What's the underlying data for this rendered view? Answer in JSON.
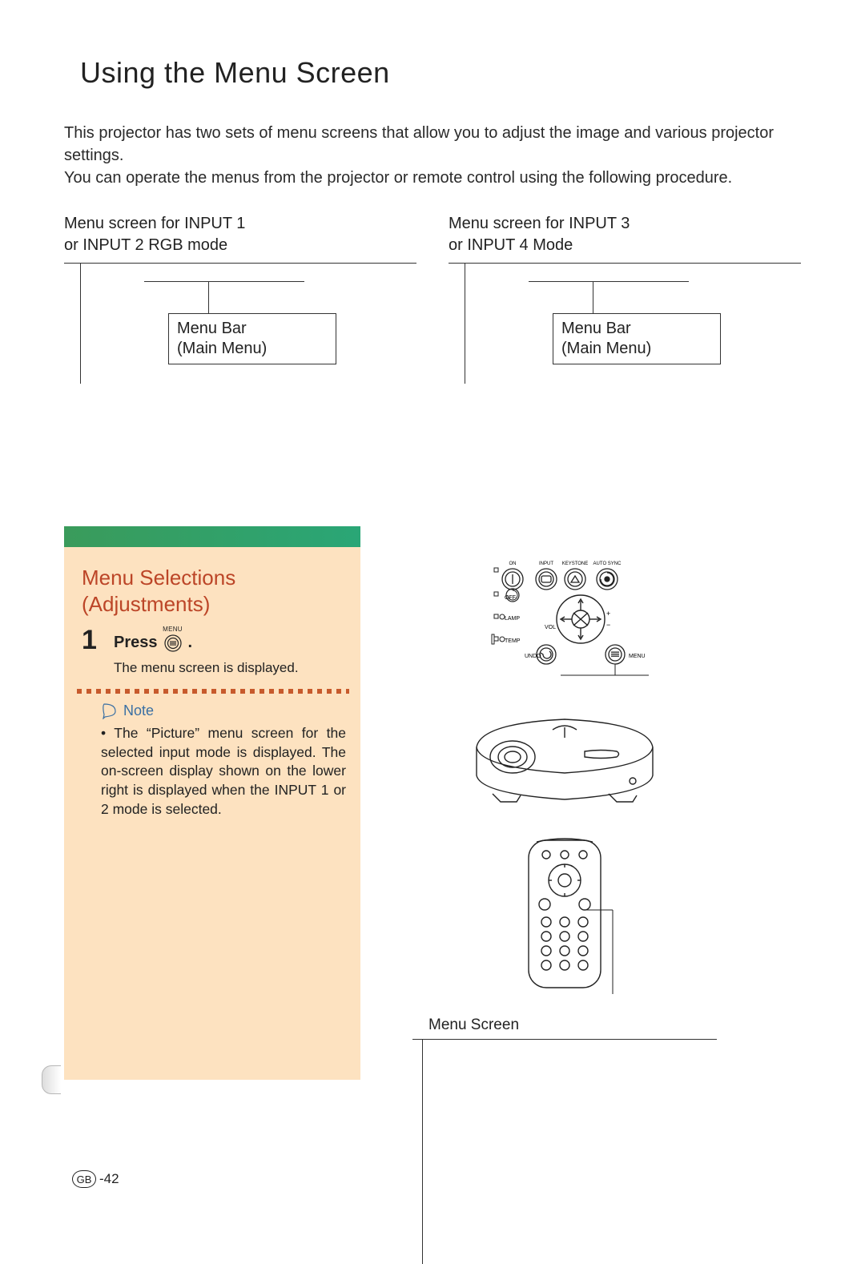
{
  "title": "Using the Menu Screen",
  "intro_para_1": "This projector has two sets of menu screens that allow you to adjust the image and various projector settings.",
  "intro_para_2": "You can operate the menus from the projector or remote control using the following procedure.",
  "columns": {
    "left": {
      "caption_line1": "Menu screen for INPUT 1",
      "caption_line2": "or INPUT 2 RGB mode",
      "menu_bar_l1": "Menu Bar",
      "menu_bar_l2": "(Main Menu)"
    },
    "right": {
      "caption_line1": "Menu screen for INPUT 3",
      "caption_line2": "or INPUT 4 Mode",
      "menu_bar_l1": "Menu Bar",
      "menu_bar_l2": "(Main Menu)"
    }
  },
  "section_title": "Menu Selections (Adjustments)",
  "step": {
    "number": "1",
    "press_label": "Press",
    "menu_btn_label": "MENU",
    "period": ".",
    "sub": "The menu screen is displayed."
  },
  "note": {
    "head": "Note",
    "body": "The “Picture” menu screen for the selected input mode is displayed. The on-screen display shown on the lower right is displayed when the INPUT 1 or 2 mode is selected."
  },
  "control_labels": {
    "on": "ON",
    "off": "OFF",
    "input": "INPUT",
    "keystone": "KEYSTONE",
    "auto_sync": "AUTO SYNC",
    "lamp": "LAMP",
    "temp": "TEMP",
    "vol": "VOL",
    "undo": "UNDO",
    "menu": "MENU"
  },
  "menu_screen_label": "Menu Screen",
  "footer": {
    "gb": "GB",
    "page": "-42"
  }
}
